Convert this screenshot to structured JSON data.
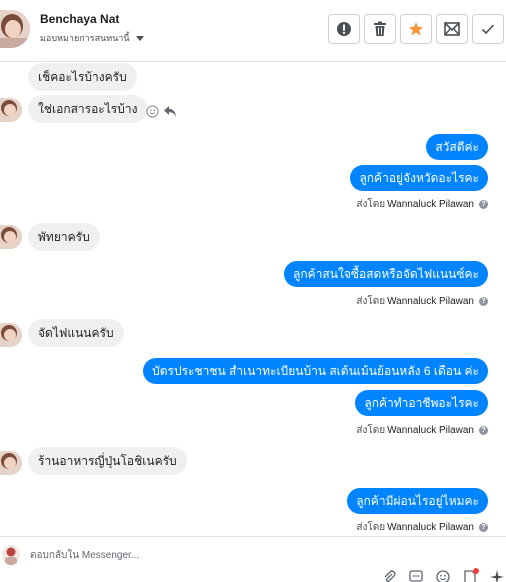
{
  "header": {
    "name": "Benchaya Nat",
    "assign_label": "มอบหมายการสนทนานี้",
    "actions": [
      "alert-icon",
      "trash-icon",
      "star-icon",
      "mark-unread-icon",
      "check-icon"
    ]
  },
  "messages": [
    {
      "side": "in",
      "text": "เช็คอะไรบ้างครับ",
      "avatar": false
    },
    {
      "side": "in",
      "text": "ใช่เอกสารอะไรบ้าง",
      "avatar": true
    },
    {
      "side": "out",
      "text": "สวัสดีค่ะ"
    },
    {
      "side": "out",
      "text": "ลูกค้าอยู่จังหวัดอะไรคะ"
    },
    {
      "side": "in",
      "text": "พัทยาครับ",
      "avatar": true
    },
    {
      "side": "out",
      "text": "ลูกค้าสนใจซื้อสดหรือจัดไฟแนนซ์คะ"
    },
    {
      "side": "in",
      "text": "จัดไฟแนนครับ",
      "avatar": true
    },
    {
      "side": "out",
      "text": "บัตรประชาชน สำเนาทะเบียนบ้าน  สเต้นเม้นย้อนหลัง 6 เดือน ค่ะ"
    },
    {
      "side": "out",
      "text": "ลูกค้าทำอาชีพอะไรคะ"
    },
    {
      "side": "in",
      "text": "ร้านอาหารญี่ปุ่นโอชิเนครับ",
      "avatar": true
    },
    {
      "side": "out",
      "text": "ลูกค้ามีผ่อนไรอยู่ไหมคะ"
    }
  ],
  "sent_by": {
    "prefix": "ส่งโดย",
    "name": "Wannaluck Pilawan",
    "help": "?"
  },
  "composer": {
    "placeholder": "ตอบกลับใน Messenger..."
  },
  "colors": {
    "outgoing": "#0084ff",
    "incoming": "#f1f0f0",
    "star": "#f7923a"
  }
}
